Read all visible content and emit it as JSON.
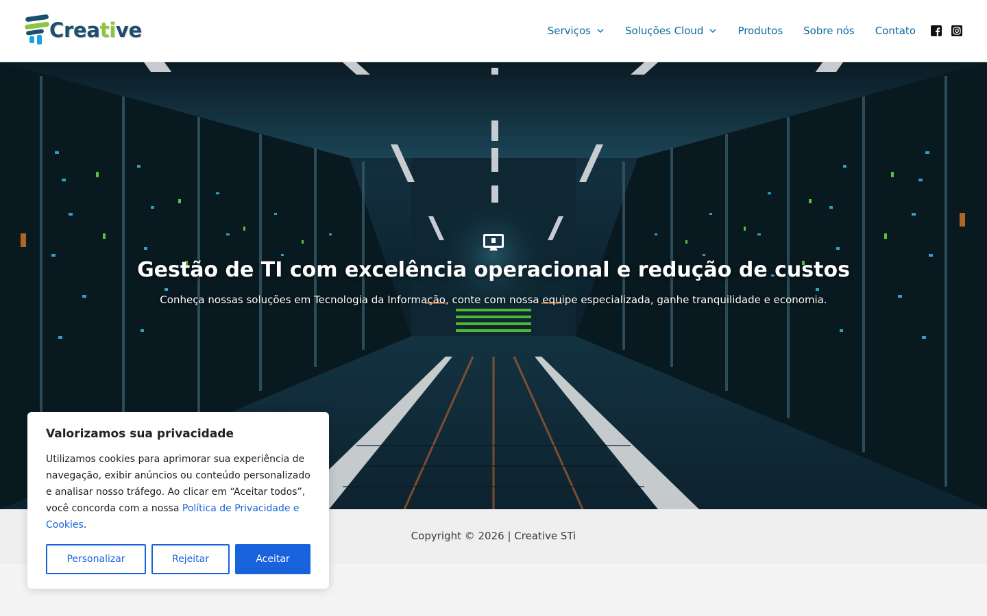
{
  "header": {
    "logo_text_a": "Crea",
    "logo_text_b": "ti",
    "logo_text_c": "ve",
    "nav": [
      {
        "label": "Serviços",
        "has_dropdown": true
      },
      {
        "label": "Soluções Cloud",
        "has_dropdown": true
      },
      {
        "label": "Produtos",
        "has_dropdown": false
      },
      {
        "label": "Sobre nós",
        "has_dropdown": false
      },
      {
        "label": "Contato",
        "has_dropdown": false
      }
    ],
    "social_icons": [
      "facebook-icon",
      "instagram-icon"
    ]
  },
  "hero": {
    "icon": "monitor-icon",
    "title": "Gestão de TI com excelência operacional e redução de custos",
    "subtitle": "Conheça nossas soluções em Tecnologia da Informação, conte com nossa equipe especializada, ganhe tranquilidade e economia."
  },
  "footer": {
    "copyright": "Copyright © 2026 | Creative STi"
  },
  "cookie_banner": {
    "title": "Valorizamos sua privacidade",
    "text": "Utilizamos cookies para aprimorar sua experiência de navegação, exibir anúncios ou conteúdo personalizado e analisar nosso tráfego. Ao clicar em “Aceitar todos”, você concorda com a nossa ",
    "link": "Política de Privacidade e Cookies",
    "text_end": ".",
    "buttons": {
      "customize": "Personalizar",
      "reject": "Rejeitar",
      "accept": "Aceitar"
    }
  },
  "colors": {
    "nav_link": "#0a6aa1",
    "brand_blue": "#1b4f6d",
    "brand_green": "#8cc63f",
    "cookie_accent": "#1863dc"
  }
}
